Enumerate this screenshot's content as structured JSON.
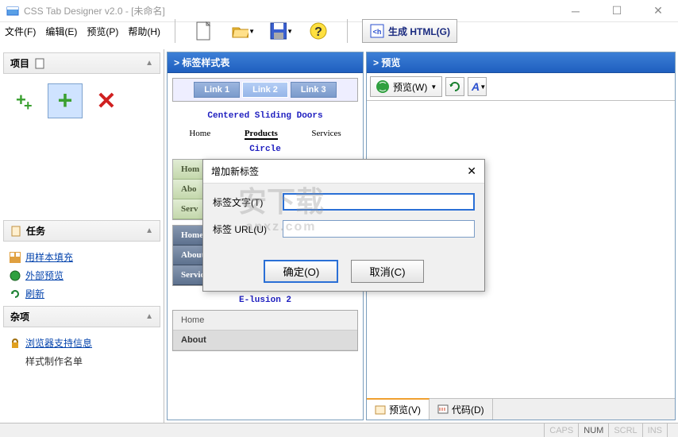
{
  "window": {
    "title": "CSS Tab Designer v2.0 - [未命名]"
  },
  "menu": {
    "file": "文件(F)",
    "edit": "编辑(E)",
    "preview": "预览(P)",
    "help": "帮助(H)"
  },
  "toolbar": {
    "generate": "生成 HTML(G)"
  },
  "sidebar": {
    "projects_title": "项目",
    "tasks_title": "任务",
    "misc_title": "杂项",
    "tasks": {
      "fill": "用样本填充",
      "external": "外部预览",
      "refresh": "刷新"
    },
    "misc": {
      "browser": "浏览器支持信息",
      "credits": "样式制作名单"
    }
  },
  "panels": {
    "styles": "> 标签样式表",
    "preview": "> 预览"
  },
  "samples": {
    "link1": "Link 1",
    "link2": "Link 2",
    "link3": "Link 3",
    "sliding": "Centered Sliding Doors",
    "home": "Home",
    "products": "Products",
    "services": "Services",
    "circle": "Circle",
    "g_home": "Hom",
    "g_about": "Abo",
    "g_serv": "Serv",
    "b_home": "Home",
    "b_about": "About",
    "b_serv": "Services",
    "elusion": "E-lusion 2",
    "gr_home": "Home",
    "gr_about": "About"
  },
  "preview_toolbar": {
    "preview_btn": "预览(W)"
  },
  "bottom_tabs": {
    "preview": "预览(V)",
    "code": "代码(D)"
  },
  "dialog": {
    "title": "增加新标签",
    "label_text": "标签文字(T)",
    "label_url": "标签 URL(U)",
    "ok": "确定(O)",
    "cancel": "取消(C)"
  },
  "status": {
    "caps": "CAPS",
    "num": "NUM",
    "scrl": "SCRL",
    "ins": "INS"
  },
  "watermark": {
    "main": "安下载",
    "sub": "anxz.com"
  }
}
